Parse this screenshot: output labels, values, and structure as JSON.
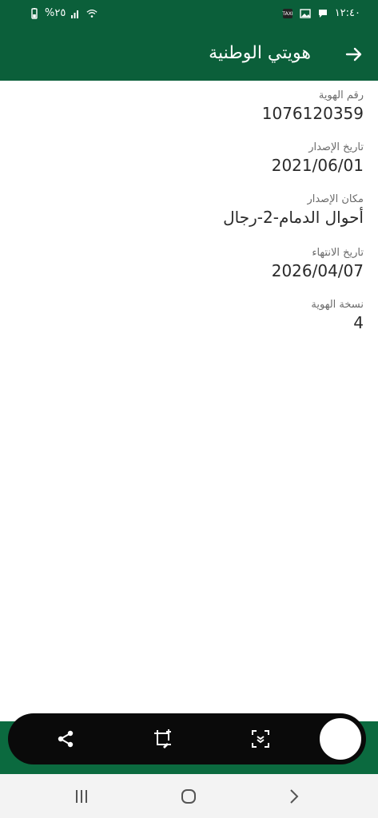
{
  "status_bar": {
    "battery_text": "%٢٥",
    "time": "١٢:٤٠"
  },
  "header": {
    "title": "هويتي الوطنية"
  },
  "fields": [
    {
      "label": "رقم الهوية",
      "value": "1076120359"
    },
    {
      "label": "تاريخ الإصدار",
      "value": "2021/06/01"
    },
    {
      "label": "مكان الإصدار",
      "value": "أحوال الدمام-2-رجال"
    },
    {
      "label": "تاريخ الانتهاء",
      "value": "2026/04/07"
    },
    {
      "label": "نسخة الهوية",
      "value": "4"
    }
  ],
  "colors": {
    "brand_green": "#0b5f3a",
    "toolbar_black": "#0a0a0a"
  },
  "icons": {
    "share": "share-icon",
    "crop_edit": "crop-edit-icon",
    "scroll_capture": "scroll-capture-icon",
    "back": "arrow-icon"
  }
}
